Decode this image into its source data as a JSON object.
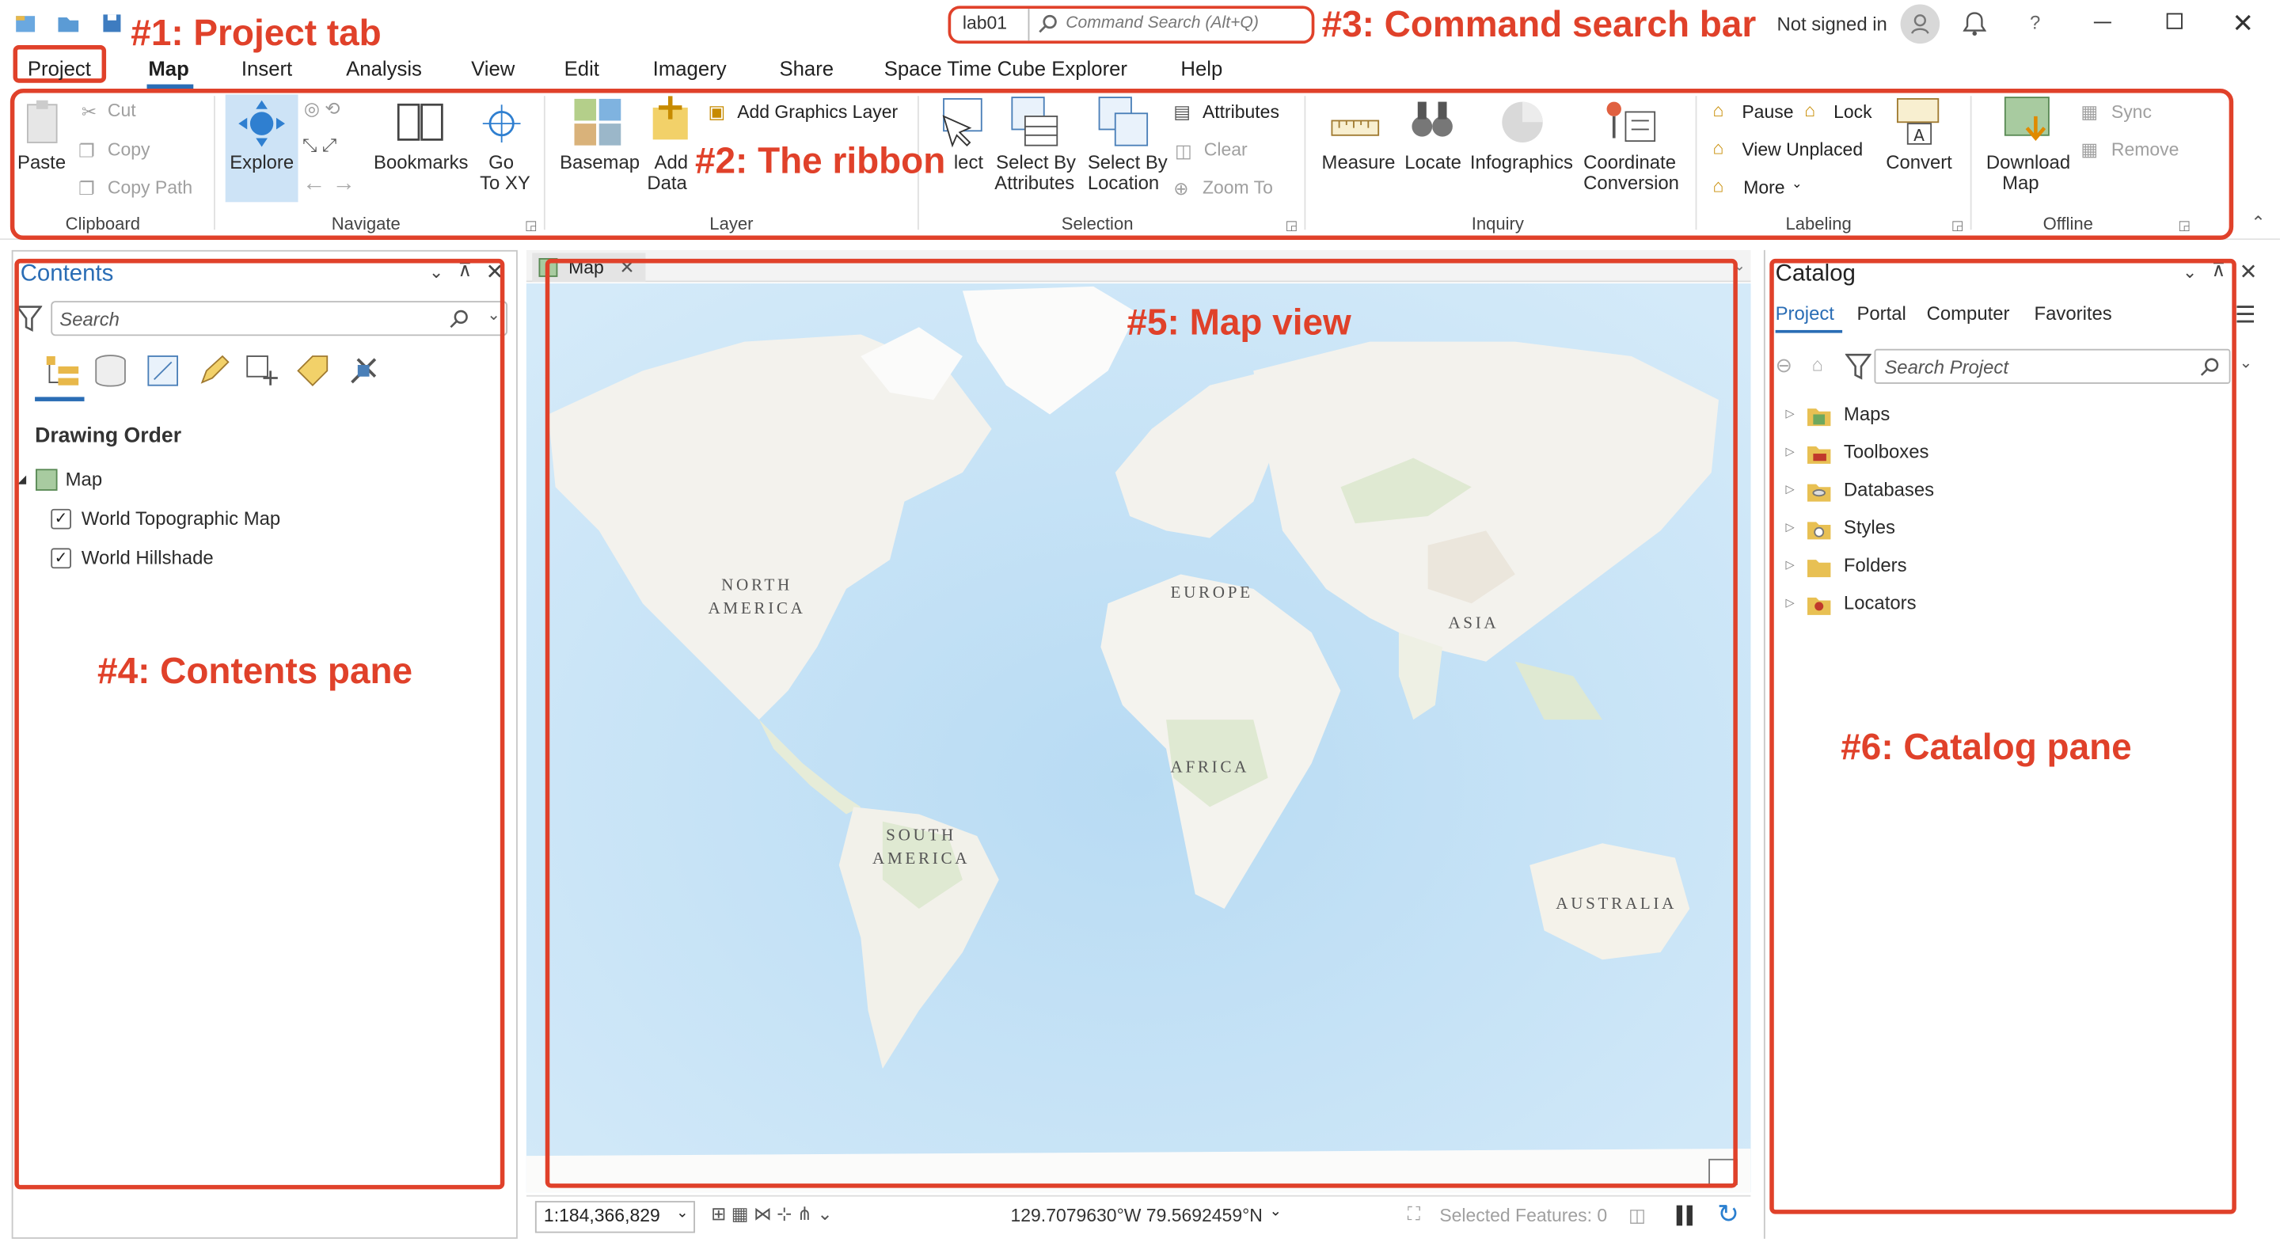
{
  "menu_tabs": [
    "Project",
    "Map",
    "Insert",
    "Analysis",
    "View",
    "Edit",
    "Imagery",
    "Share",
    "Space Time Cube Explorer",
    "Help"
  ],
  "title_bar": {
    "project_name": "lab01",
    "command_search_placeholder": "Command Search (Alt+Q)",
    "sign_in_status": "Not signed in"
  },
  "ribbon": {
    "clipboard": {
      "group_label": "Clipboard",
      "paste": "Paste",
      "cut": "Cut",
      "copy": "Copy",
      "copy_path": "Copy Path"
    },
    "navigate": {
      "group_label": "Navigate",
      "explore": "Explore",
      "bookmarks": "Bookmarks",
      "goto_xy_1": "Go",
      "goto_xy_2": "To XY"
    },
    "layer": {
      "group_label": "Layer",
      "basemap": "Basemap",
      "add_data_1": "Add",
      "add_data_2": "Data",
      "add_graphics_layer": "Add Graphics Layer"
    },
    "selection": {
      "group_label": "Selection",
      "select": "lect",
      "select_by_attributes_1": "Select By",
      "select_by_attributes_2": "Attributes",
      "select_by_location_1": "Select By",
      "select_by_location_2": "Location",
      "attributes": "Attributes",
      "clear": "Clear",
      "zoom_to": "Zoom To"
    },
    "inquiry": {
      "group_label": "Inquiry",
      "measure": "Measure",
      "locate": "Locate",
      "infographics": "Infographics",
      "coordinate_conversion_1": "Coordinate",
      "coordinate_conversion_2": "Conversion"
    },
    "labeling": {
      "group_label": "Labeling",
      "pause": "Pause",
      "lock": "Lock",
      "view_unplaced": "View Unplaced",
      "more": "More",
      "convert": "Convert"
    },
    "offline": {
      "group_label": "Offline",
      "download_map_1": "Download",
      "download_map_2": "Map",
      "sync": "Sync",
      "remove": "Remove"
    }
  },
  "contents": {
    "title": "Contents",
    "search_placeholder": "Search",
    "section_heading": "Drawing Order",
    "map_name": "Map",
    "layers": [
      {
        "name": "World Topographic Map",
        "checked": true
      },
      {
        "name": "World Hillshade",
        "checked": true
      }
    ]
  },
  "map_view": {
    "tab_label": "Map",
    "continents": [
      "NORTH\nAMERICA",
      "EUROPE",
      "ASIA",
      "AFRICA",
      "SOUTH\nAMERICA",
      "AUSTRALIA"
    ],
    "scale": "1:184,366,829",
    "coordinates": "129.7079630°W 79.5692459°N",
    "selected_features": "Selected Features: 0"
  },
  "catalog": {
    "title": "Catalog",
    "tabs": [
      "Project",
      "Portal",
      "Computer",
      "Favorites"
    ],
    "search_placeholder": "Search Project",
    "items": [
      "Maps",
      "Toolboxes",
      "Databases",
      "Styles",
      "Folders",
      "Locators"
    ]
  },
  "annotations": {
    "project_tab": "#1: Project tab",
    "ribbon": "#2: The ribbon",
    "command_search": "#3: Command search bar",
    "contents_pane": "#4: Contents pane",
    "map_view": "#5: Map view",
    "catalog_pane": "#6: Catalog pane"
  },
  "colors": {
    "annotation_red": "#e0412a",
    "accent_blue": "#2a6db5",
    "ocean": "#cfe8f8",
    "land": "#f4f3ee",
    "vegetation": "#dfe9d2"
  }
}
